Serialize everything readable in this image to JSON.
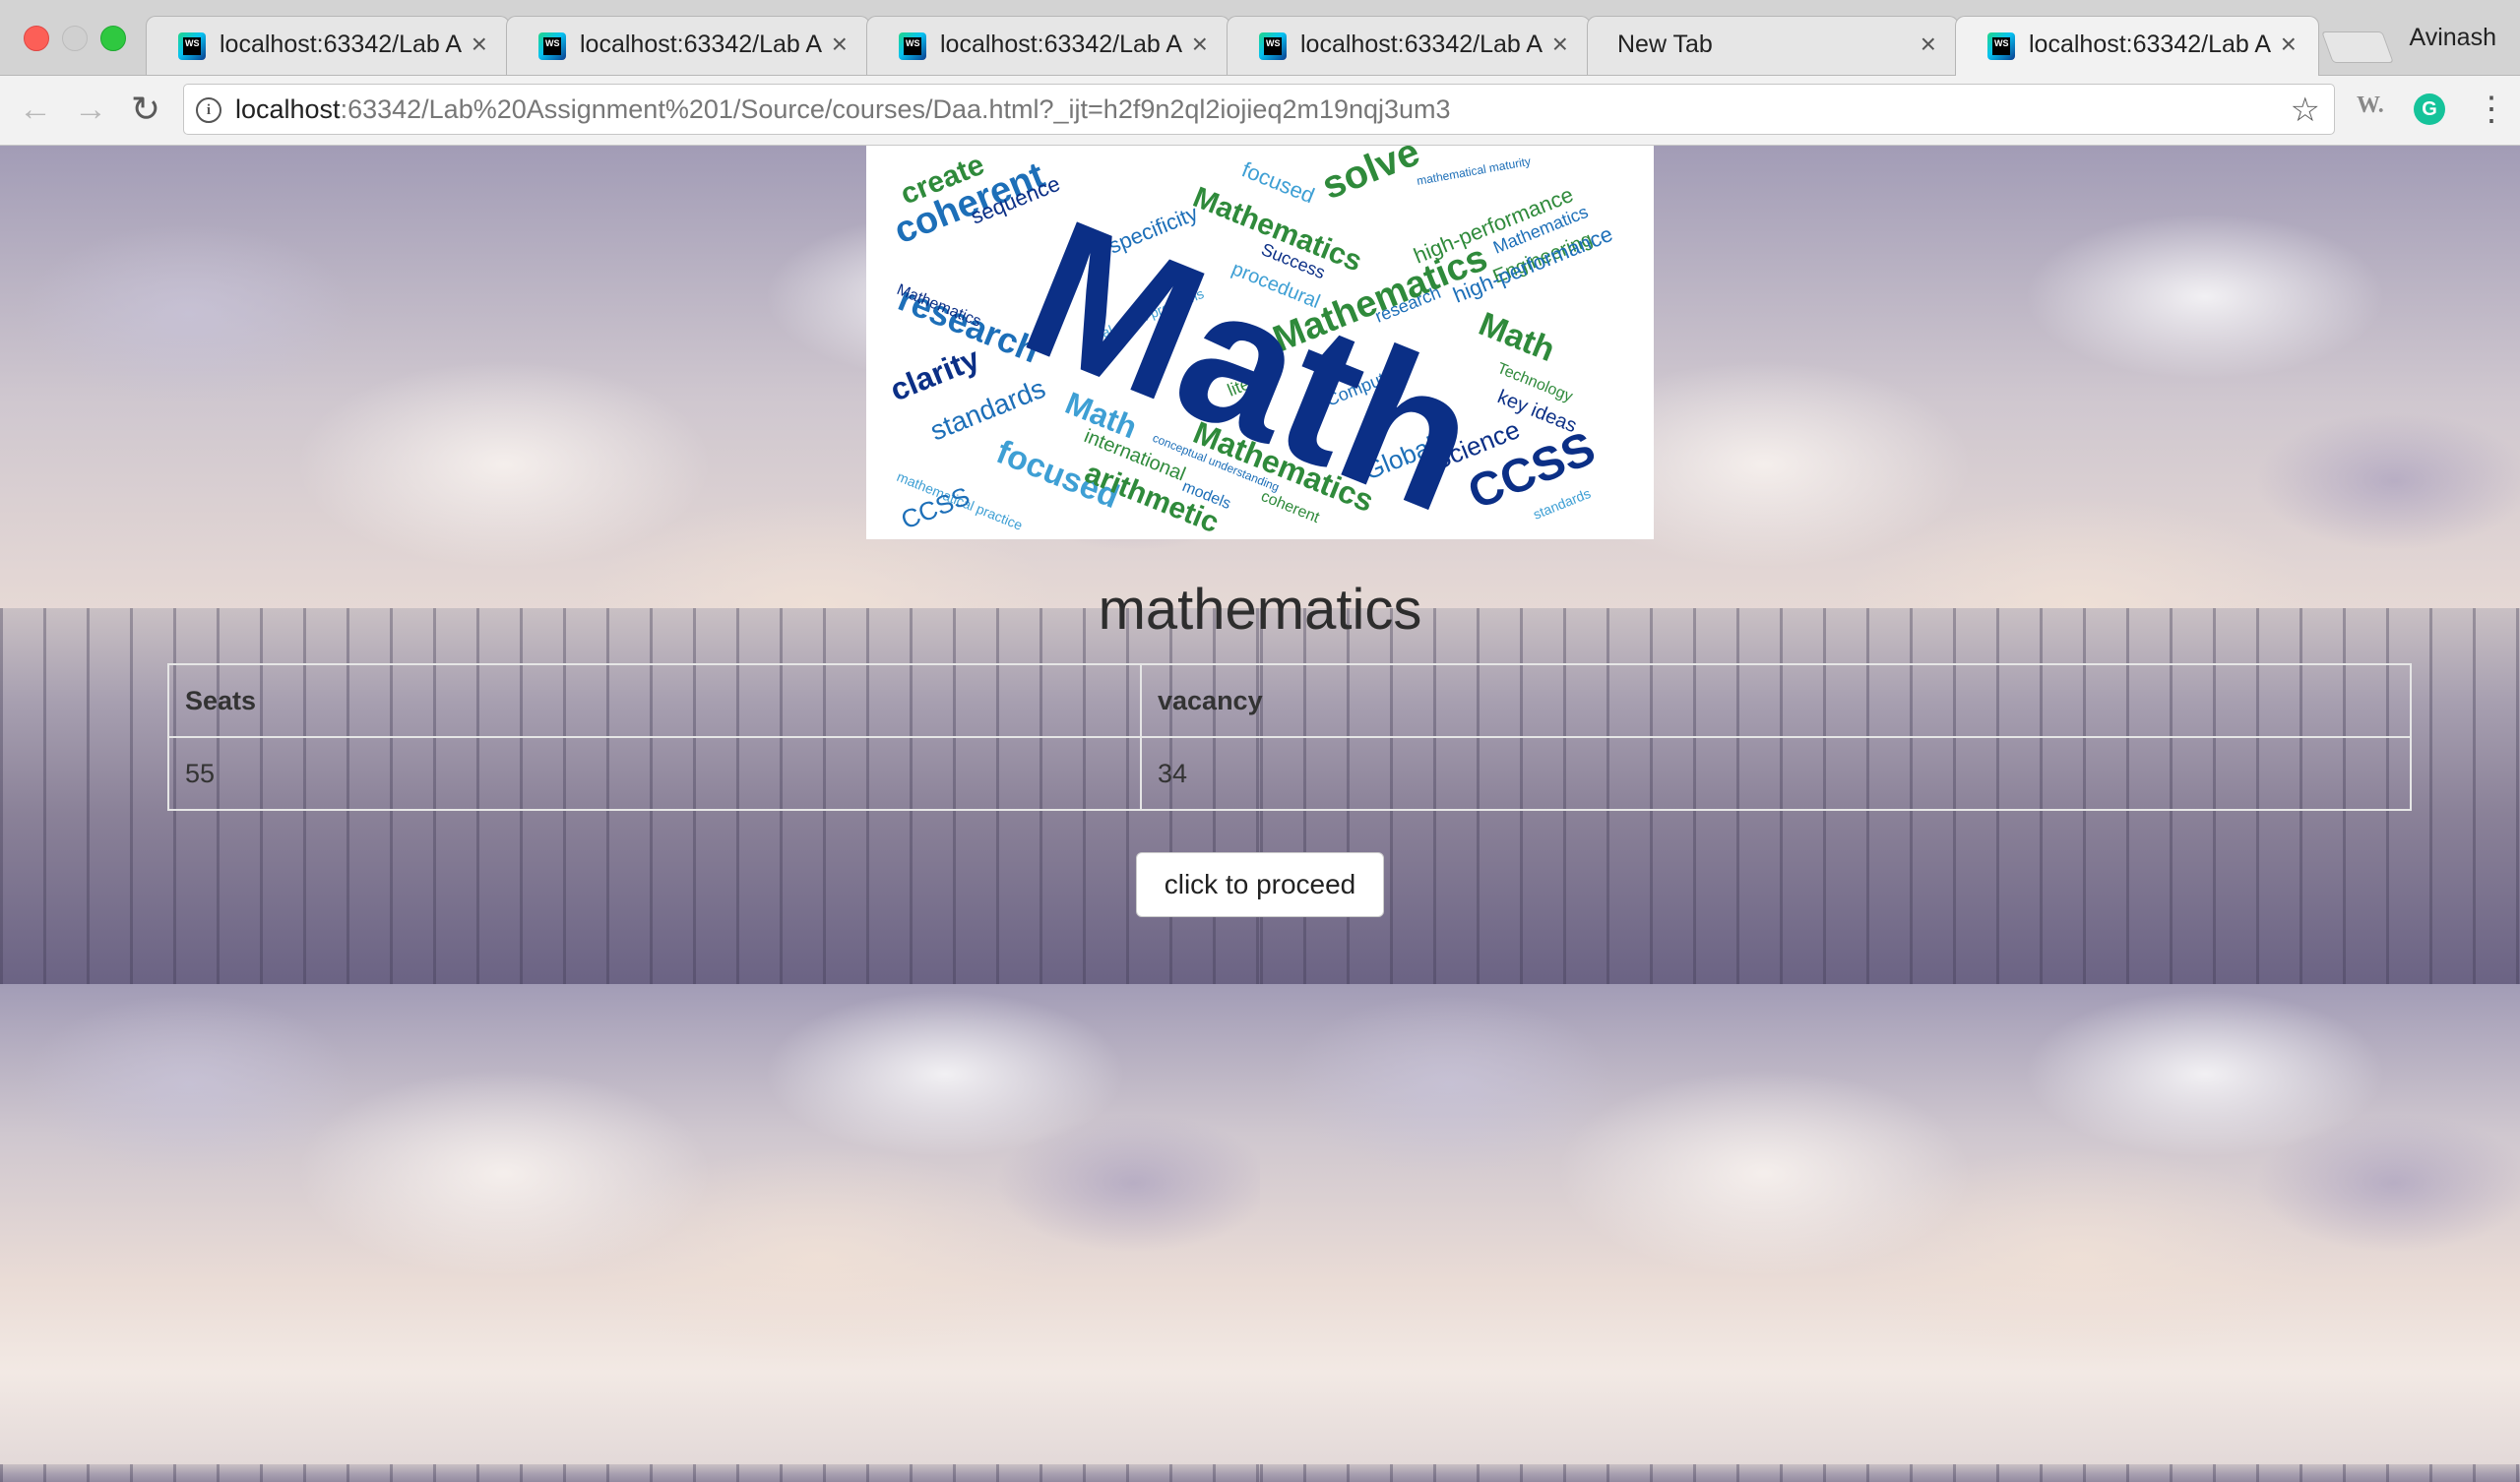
{
  "browser": {
    "tabs": [
      {
        "title": "localhost:63342/Lab A",
        "has_favicon": true,
        "active": false
      },
      {
        "title": "localhost:63342/Lab A",
        "has_favicon": true,
        "active": false
      },
      {
        "title": "localhost:63342/Lab A",
        "has_favicon": true,
        "active": false
      },
      {
        "title": "localhost:63342/Lab A",
        "has_favicon": true,
        "active": false
      },
      {
        "title": "New Tab",
        "has_favicon": false,
        "active": false
      },
      {
        "title": "localhost:63342/Lab A",
        "has_favicon": true,
        "active": true
      }
    ],
    "favicon_text": "WS",
    "profile_name": "Avinash",
    "url_host": "localhost",
    "url_rest": ":63342/Lab%20Assignment%201/Source/courses/Daa.html?_ijt=h2f9n2ql2iojieq2m19nqj3um3",
    "extensions": {
      "w_label": "W.",
      "g_label": "G"
    }
  },
  "page": {
    "heading": "mathematics",
    "table": {
      "headers": [
        "Seats",
        "vacancy"
      ],
      "rows": [
        [
          "55",
          "34"
        ]
      ]
    },
    "button_label": "click to proceed",
    "word_cloud": {
      "main": "Math",
      "words": [
        "create",
        "coherent",
        "sequence",
        "focused",
        "solve",
        "mathematical maturity",
        "Mathematics",
        "specificity",
        "Success",
        "procedural",
        "high-performance",
        "Mathematics",
        "Engineering",
        "research",
        "Mathematics",
        "real-world problems",
        "Mathematics",
        "research",
        "Math",
        "high-performance",
        "clarity",
        "Math",
        "literacy",
        "Computing",
        "Technology",
        "standards",
        "key ideas",
        "focused",
        "international",
        "conceptual understanding",
        "Mathematics",
        "Global",
        "Science",
        "mathematical practice",
        "arithmetic",
        "models",
        "coherent",
        "CCSS",
        "CCSS",
        "standards"
      ]
    },
    "colors": {
      "word_dark": "#0b2f86",
      "word_green": "#2f8a3b",
      "word_blue": "#1d6fb8",
      "word_light": "#3e9fd4"
    }
  }
}
